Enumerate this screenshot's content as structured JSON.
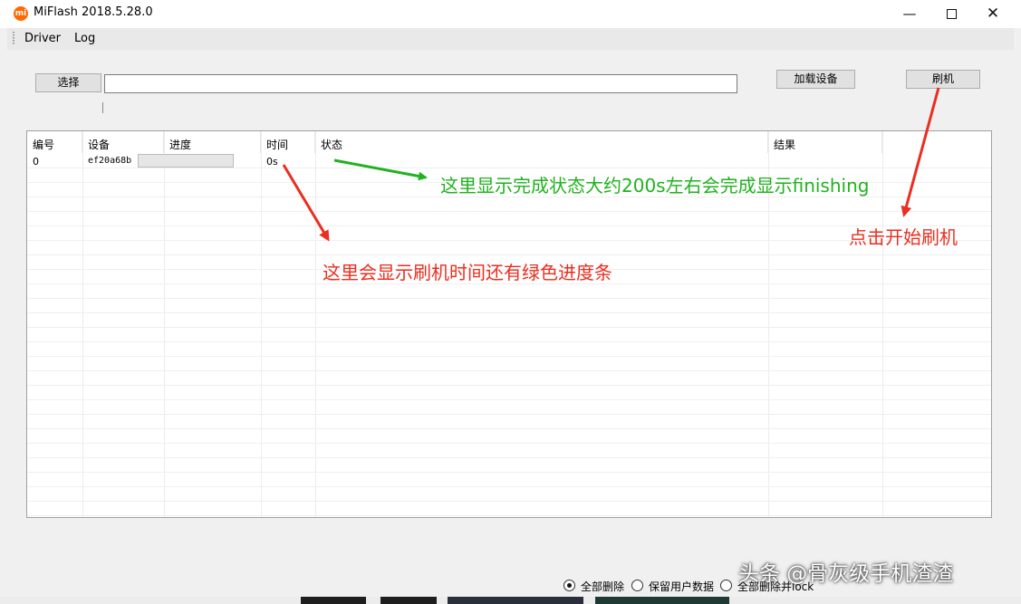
{
  "window": {
    "title": "MiFlash 2018.5.28.0",
    "icon_text": "mi"
  },
  "menu": {
    "items": [
      "Driver",
      "Log"
    ]
  },
  "toolbar": {
    "select_label": "选择",
    "path_value": "",
    "load_devices_label": "加载设备",
    "flash_label": "刷机"
  },
  "table": {
    "columns": [
      "编号",
      "设备",
      "进度",
      "时间",
      "状态",
      "结果"
    ],
    "rows": [
      {
        "id": "0",
        "device": "ef20a68b",
        "progress": 0,
        "time": "0s",
        "status": "",
        "result": ""
      }
    ]
  },
  "radios": {
    "options": [
      {
        "label": "全部删除",
        "selected": true
      },
      {
        "label": "保留用户数据",
        "selected": false
      },
      {
        "label": "全部删除并lock",
        "selected": false
      }
    ]
  },
  "annotations": {
    "status_note": "这里显示完成状态大约200s左右会完成显示finishing",
    "flash_note": "点击开始刷机",
    "time_note": "这里会显示刷机时间还有绿色进度条"
  },
  "watermark": "头条 @骨灰级手机渣渣",
  "colors": {
    "annotation_green": "#21b21f",
    "annotation_red": "#ea2e1f",
    "progress_fill": "#06b025",
    "brand_orange": "#ff6900"
  }
}
